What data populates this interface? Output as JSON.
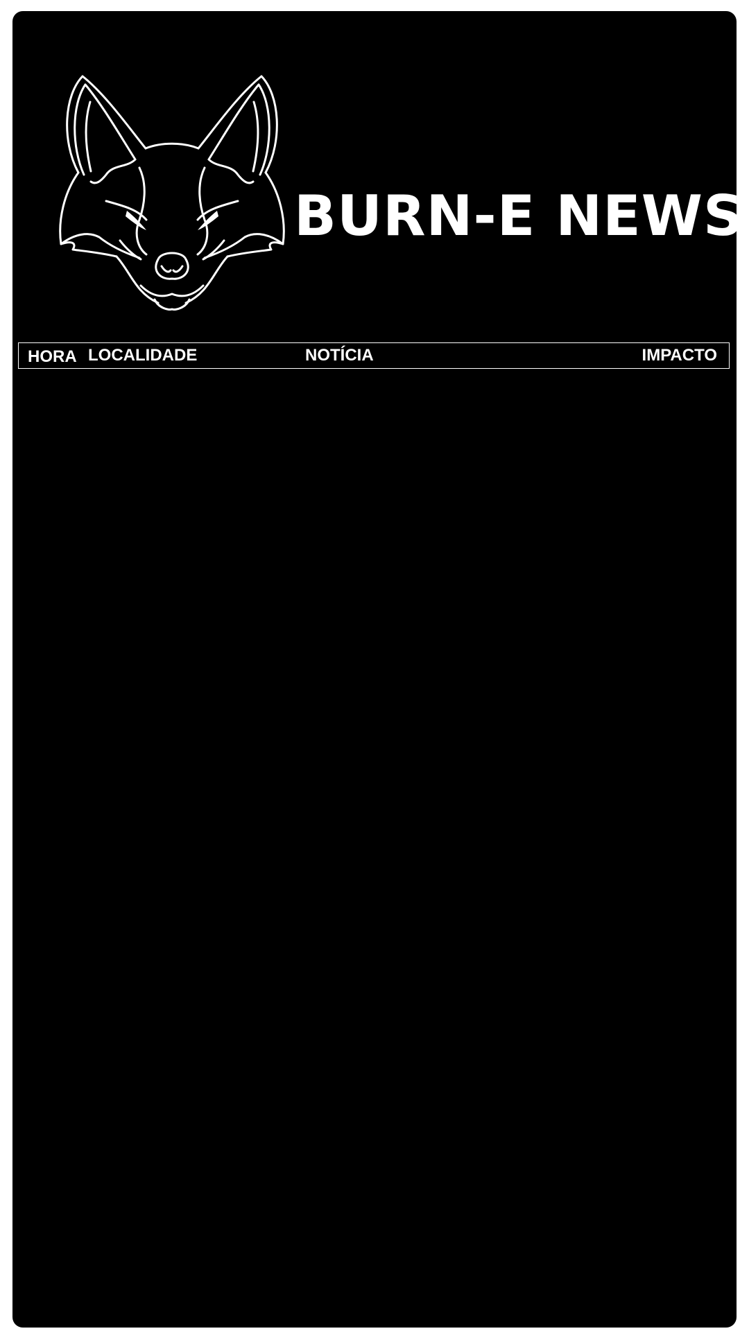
{
  "app": {
    "title": "BURN-E NEWS",
    "logo_icon": "fox-head-icon"
  },
  "table": {
    "columns": [
      "HORA",
      "LOCALIDADE",
      "NOTÍCIA",
      "IMPACTO"
    ],
    "rows": []
  },
  "colors": {
    "background": "#000000",
    "foreground": "#ffffff",
    "outer": "#ffffff"
  }
}
